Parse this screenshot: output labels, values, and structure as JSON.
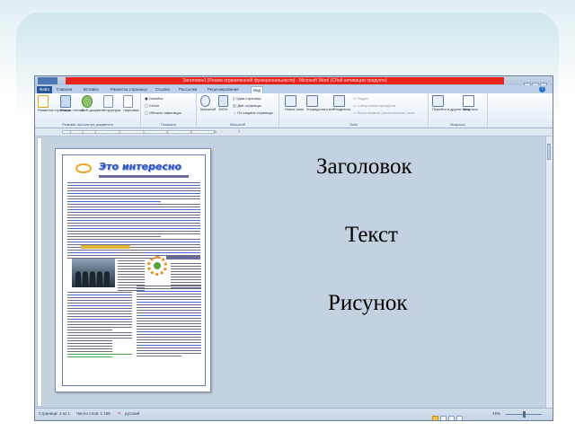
{
  "window": {
    "title": "Заголовок1 [Режим ограниченной функциональности] - Microsoft Word (Сбой активации продукта)",
    "tabs": [
      "Файл",
      "Главная",
      "Вставка",
      "Разметка страницы",
      "Ссылки",
      "Рассылки",
      "Рецензирование",
      "Вид"
    ],
    "active_tab": "Вид",
    "help_glyph": "?"
  },
  "ribbon": {
    "groups": [
      {
        "label": "Режимы просмотра документа",
        "buttons": [
          "Разметка страницы",
          "Режим чтения",
          "Веб-документ",
          "Структура",
          "Черновик"
        ]
      },
      {
        "label": "Показать",
        "buttons": [
          "Линейка",
          "Сетка",
          "Область навигации"
        ]
      },
      {
        "label": "Масштаб",
        "buttons": [
          "Масштаб",
          "100%",
          "Одна страница",
          "Две страницы",
          "По ширине страницы"
        ]
      },
      {
        "label": "Окно",
        "buttons": [
          "Новое окно",
          "Упорядочить все",
          "Разделить",
          "Рядом",
          "Синхронная прокрутка",
          "Восстановить расположение окна"
        ]
      },
      {
        "label": "Макросы",
        "buttons": [
          "Перейти в другое окно",
          "Макросы"
        ]
      }
    ]
  },
  "ruler": {
    "marks": "· 1 · 2 · 1 · · · 2 · · · 3 · · · 4 · · · 5 · · · 6 · · · 7 ·"
  },
  "document": {
    "banner_title": "Это интересно"
  },
  "statusbar": {
    "page": "Страница: 1 из 1",
    "words": "Число слов: 1 165",
    "language": "русский",
    "zoom": "45%"
  },
  "slide": {
    "labels": [
      "Заголовок",
      "Текст",
      "Рисунок"
    ]
  },
  "colors": {
    "title_bar_red": "#e8231b",
    "file_tab": "#2b579a",
    "banner_blue": "#2f52c4"
  }
}
